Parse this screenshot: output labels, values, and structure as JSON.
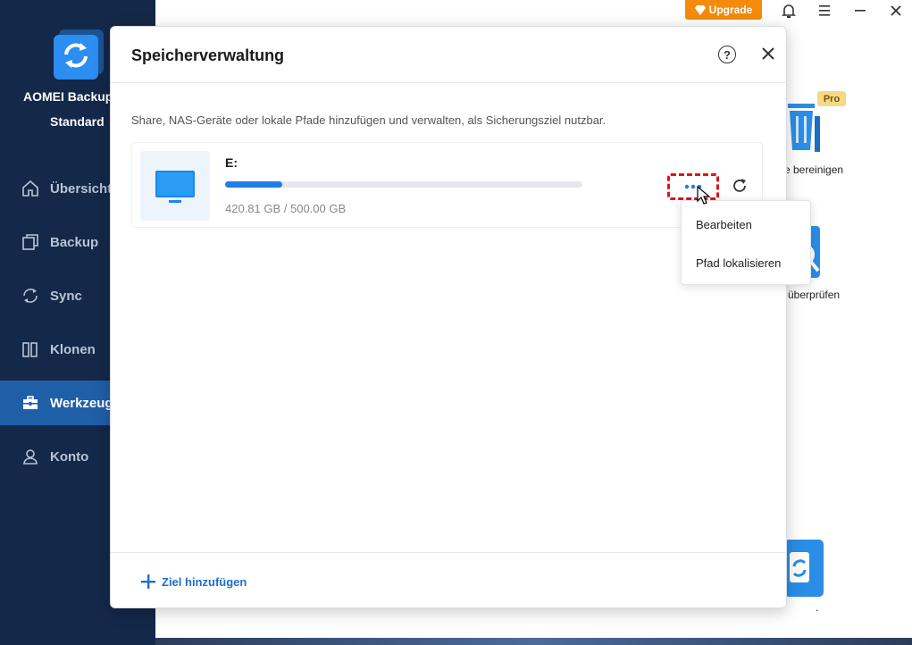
{
  "app": {
    "name": "AOMEI Backupper",
    "edition": "Standard",
    "upgrade_label": "Upgrade"
  },
  "sidebar": {
    "items": [
      {
        "label": "Übersicht",
        "icon": "home-icon"
      },
      {
        "label": "Backup",
        "icon": "backup-icon"
      },
      {
        "label": "Sync",
        "icon": "sync-icon"
      },
      {
        "label": "Klonen",
        "icon": "clone-icon"
      },
      {
        "label": "Werkzeuge",
        "icon": "toolbox-icon",
        "active": true
      },
      {
        "label": "Konto",
        "icon": "user-icon"
      }
    ]
  },
  "background": {
    "pro_badge": "Pro",
    "tool1_label": "e bereinigen",
    "tool2_label": "überprüfen",
    "tool3_label": "."
  },
  "dialog": {
    "title": "Speicherverwaltung",
    "description": "Share, NAS-Geräte oder lokale Pfade hinzufügen und verwalten, als Sicherungsziel nutzbar.",
    "drive": {
      "name": "E:",
      "size_text": "420.81 GB / 500.00 GB",
      "bar_fraction": 0.16
    },
    "add_target_label": "Ziel hinzufügen"
  },
  "context_menu": {
    "items": [
      "Bearbeiten",
      "Pfad lokalisieren"
    ]
  },
  "colors": {
    "sidebar_bg": "#14284a",
    "active_item": "#1f5fa8",
    "accent": "#1c7ee6",
    "upgrade": "#f58a0b",
    "highlight_box": "#e0141e"
  }
}
